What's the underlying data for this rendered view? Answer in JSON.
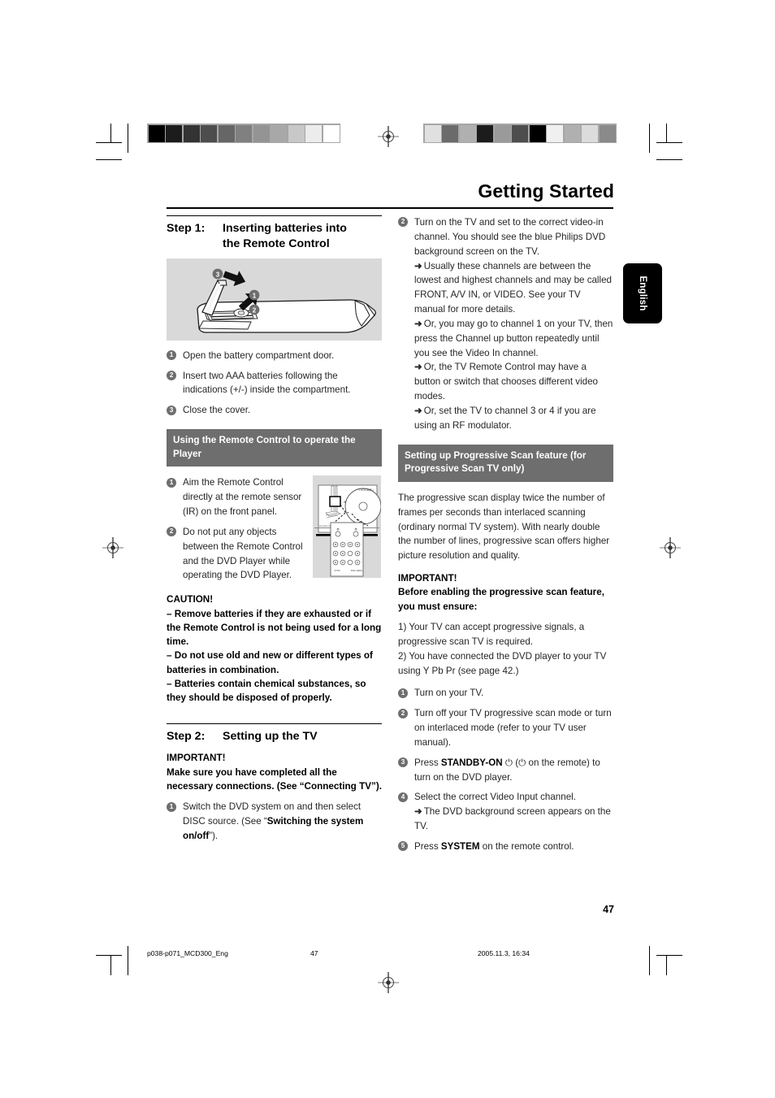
{
  "header": {
    "title": "Getting Started",
    "language_tab": "English"
  },
  "calibration": {
    "left_bar": [
      "#000000",
      "#1c1c1c",
      "#333333",
      "#4d4d4d",
      "#666666",
      "#808080",
      "#949494",
      "#a8a8a8",
      "#c8c8c8",
      "#ececec",
      "#ffffff"
    ],
    "right_bar": [
      "#e0e0e0",
      "#6b6b6b",
      "#b0b0b0",
      "#1c1c1c",
      "#9a9a9a",
      "#4d4d4d",
      "#000000",
      "#f0f0f0",
      "#b0b0b0",
      "#dcdcdc",
      "#8a8a8a"
    ],
    "bar_frame_color": "#a6a6a6"
  },
  "left_column": {
    "step1": {
      "label": "Step 1:",
      "title_line1": "Inserting batteries into",
      "title_line2": "the Remote Control",
      "figure_name": "remote-control-battery-diagram",
      "figure_callouts": [
        "1",
        "2",
        "3"
      ],
      "steps": [
        {
          "num": "1",
          "text": "Open the battery compartment door."
        },
        {
          "num": "2",
          "text": "Insert two AAA batteries following the indications (+/-) inside the compartment."
        },
        {
          "num": "3",
          "text": "Close the cover."
        }
      ]
    },
    "remote_banner": "Using the Remote Control to operate the Player",
    "remote_steps": [
      {
        "num": "1",
        "text": "Aim the Remote Control directly at the remote sensor (IR) on the front panel."
      },
      {
        "num": "2",
        "text": "Do not put any objects between the Remote Control and the DVD Player while operating the DVD Player."
      }
    ],
    "player_figure_name": "dvd-player-front-panel-diagram",
    "caution": {
      "heading": "CAUTION!",
      "lines": [
        "–  Remove batteries if they are exhausted or if the Remote Control is not being used for a long time.",
        "–  Do not use old and new or different types of batteries in combination.",
        "–  Batteries contain chemical substances, so they should be disposed of properly."
      ]
    },
    "step2": {
      "label": "Step 2:",
      "title": "Setting up the TV",
      "important_heading": "IMPORTANT!",
      "important_text": "Make sure you have completed all the necessary connections. (See “Connecting TV”).",
      "step_num": "1",
      "step_text_a": "Switch the DVD system on and then select DISC source. (See “",
      "step_text_bold": "Switching the system on/off",
      "step_text_b": "”)."
    }
  },
  "right_column": {
    "step2_item": {
      "num": "2",
      "text": "Turn on the TV and set to the correct video-in channel. You should see the blue Philips DVD background screen on the TV.",
      "arrows": [
        "Usually these channels are between the lowest and highest channels and may be called FRONT, A/V IN, or VIDEO. See your TV manual for more details.",
        "Or, you may go to channel 1 on your TV, then press the Channel up button repeatedly until you see the Video In channel.",
        "Or, the TV Remote Control may have a button or switch that chooses different video modes.",
        "Or, set the TV to channel 3 or 4 if you are using an RF modulator."
      ]
    },
    "progressive_banner": "Setting up Progressive Scan feature (for Progressive Scan TV only)",
    "progressive_intro": "The progressive scan display twice the number of frames per seconds than interlaced scanning (ordinary normal TV system). With nearly double the number of lines, progressive scan offers higher picture resolution and quality.",
    "important": {
      "heading": "IMPORTANT!",
      "bold_line": "Before enabling the progressive scan feature, you must ensure:",
      "point1": "1) Your TV can accept progressive signals, a progressive scan TV is required.",
      "point2": "2) You have connected the DVD player to your TV using Y Pb Pr (see page 42.)"
    },
    "progressive_steps": [
      {
        "num": "1",
        "plain_a": "Turn on your TV.",
        "bold": "",
        "plain_b": ""
      },
      {
        "num": "2",
        "plain_a": "Turn off your TV progressive scan mode or turn on interlaced mode (refer to your TV user manual).",
        "bold": "",
        "plain_b": ""
      },
      {
        "num": "3",
        "plain_a": "Press ",
        "bold": "STANDBY-ON",
        "plain_b": " ⏻ (⏻  on the remote) to turn on the DVD player."
      },
      {
        "num": "4",
        "plain_a": "Select the correct Video Input channel.",
        "bold": "",
        "plain_b": "",
        "arrow": "The DVD background screen appears on the TV."
      },
      {
        "num": "5",
        "plain_a": "Press ",
        "bold": "SYSTEM",
        "plain_b": " on the remote control."
      }
    ]
  },
  "footer": {
    "page_number": "47",
    "filename": "p038-p071_MCD300_Eng",
    "folio_repeat": "47",
    "timestamp": "2005.11.3, 16:34"
  },
  "symbols": {
    "arrow": "➜",
    "power": "⏻"
  }
}
